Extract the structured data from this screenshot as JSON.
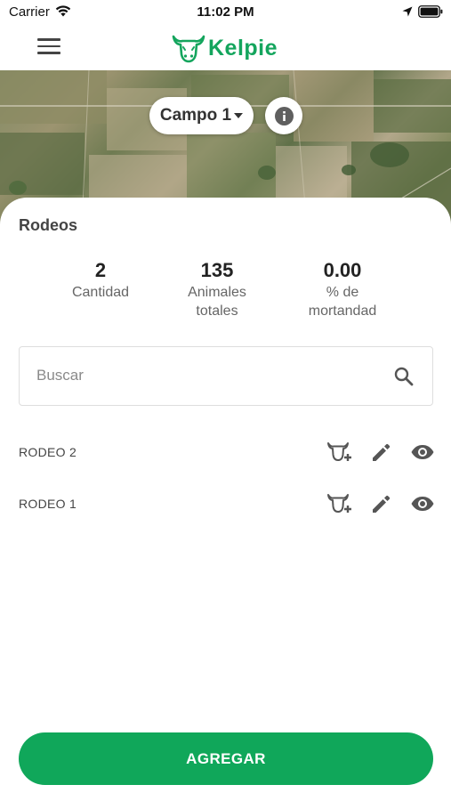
{
  "status_bar": {
    "carrier": "Carrier",
    "time": "11:02 PM"
  },
  "header": {
    "logo_text": "Kelpie",
    "logo_color": "#14a55d"
  },
  "map": {
    "campo_selected": "Campo 1"
  },
  "rodeos": {
    "title": "Rodeos",
    "stats": [
      {
        "value": "2",
        "label_line1": "Cantidad",
        "label_line2": ""
      },
      {
        "value": "135",
        "label_line1": "Animales",
        "label_line2": "totales"
      },
      {
        "value": "0.00",
        "label_line1": "% de",
        "label_line2": "mortandad"
      }
    ],
    "search": {
      "placeholder": "Buscar",
      "value": ""
    },
    "items": [
      {
        "name": "RODEO 2"
      },
      {
        "name": "RODEO 1"
      }
    ]
  },
  "actions": {
    "add_label": "AGREGAR",
    "accent": "#10a75a"
  }
}
